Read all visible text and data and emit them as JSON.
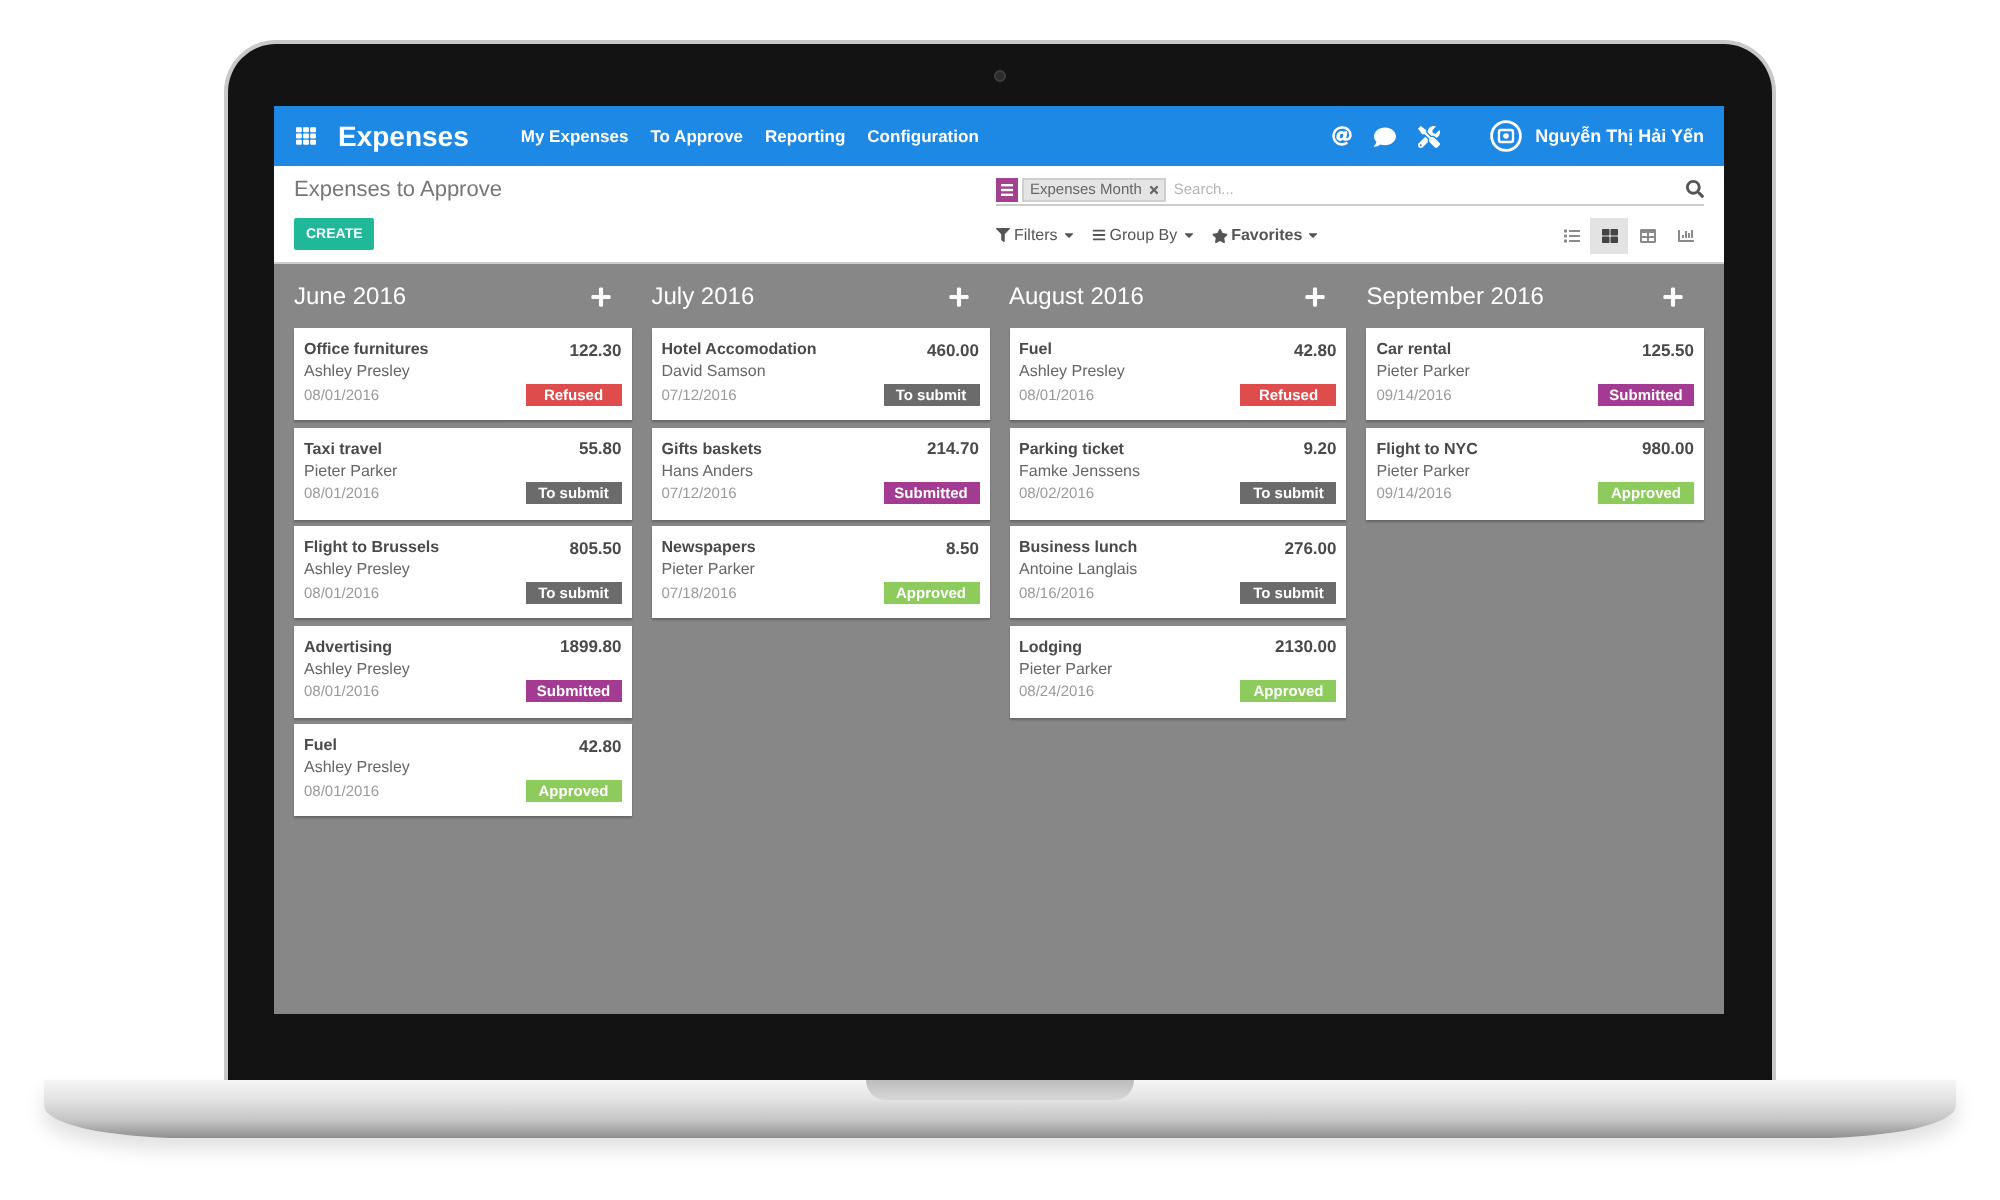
{
  "navbar": {
    "app_name": "Expenses",
    "menu": [
      "My Expenses",
      "To Approve",
      "Reporting",
      "Configuration"
    ],
    "user": "Nguyễn Thị Hải Yến"
  },
  "control_panel": {
    "breadcrumb": "Expenses to Approve",
    "create_button": "CREATE",
    "search": {
      "facets": [
        {
          "label": "Expenses Month"
        }
      ],
      "placeholder": "Search..."
    },
    "filter_menus": [
      {
        "kind": "filters",
        "label": "Filters"
      },
      {
        "kind": "group_by",
        "label": "Group By"
      },
      {
        "kind": "favorites",
        "label": "Favorites"
      }
    ],
    "views": [
      {
        "kind": "list",
        "selected": false
      },
      {
        "kind": "kanban",
        "selected": true
      },
      {
        "kind": "pivot",
        "selected": false
      },
      {
        "kind": "graph",
        "selected": false
      }
    ]
  },
  "columns": [
    {
      "title": "June 2016",
      "cards": [
        {
          "name": "Office furnitures",
          "amount": "122.30",
          "employee": "Ashley Presley",
          "date": "08/01/2016",
          "status": "Refused",
          "color": "#de4c4c"
        },
        {
          "name": "Taxi travel",
          "amount": "55.80",
          "employee": "Pieter Parker",
          "date": "08/01/2016",
          "status": "To submit",
          "color": "#6b6b6b"
        },
        {
          "name": "Flight to Brussels",
          "amount": "805.50",
          "employee": "Ashley Presley",
          "date": "08/01/2016",
          "status": "To submit",
          "color": "#6b6b6b"
        },
        {
          "name": "Advertising",
          "amount": "1899.80",
          "employee": "Ashley Presley",
          "date": "08/01/2016",
          "status": "Submitted",
          "color": "#a33b92"
        },
        {
          "name": "Fuel",
          "amount": "42.80",
          "employee": "Ashley Presley",
          "date": "08/01/2016",
          "status": "Approved",
          "color": "#8ecb5d"
        }
      ]
    },
    {
      "title": "July 2016",
      "cards": [
        {
          "name": "Hotel Accomodation",
          "amount": "460.00",
          "employee": "David Samson",
          "date": "07/12/2016",
          "status": "To submit",
          "color": "#6b6b6b"
        },
        {
          "name": "Gifts baskets",
          "amount": "214.70",
          "employee": "Hans Anders",
          "date": "07/12/2016",
          "status": "Submitted",
          "color": "#a33b92"
        },
        {
          "name": "Newspapers",
          "amount": "8.50",
          "employee": "Pieter Parker",
          "date": "07/18/2016",
          "status": "Approved",
          "color": "#8ecb5d"
        }
      ]
    },
    {
      "title": "August 2016",
      "cards": [
        {
          "name": "Fuel",
          "amount": "42.80",
          "employee": "Ashley Presley",
          "date": "08/01/2016",
          "status": "Refused",
          "color": "#de4c4c"
        },
        {
          "name": "Parking ticket",
          "amount": "9.20",
          "employee": "Famke Jenssens",
          "date": "08/02/2016",
          "status": "To submit",
          "color": "#6b6b6b"
        },
        {
          "name": "Business lunch",
          "amount": "276.00",
          "employee": "Antoine Langlais",
          "date": "08/16/2016",
          "status": "To submit",
          "color": "#6b6b6b"
        },
        {
          "name": "Lodging",
          "amount": "2130.00",
          "employee": "Pieter Parker",
          "date": "08/24/2016",
          "status": "Approved",
          "color": "#8ecb5d"
        }
      ]
    },
    {
      "title": "September 2016",
      "cards": [
        {
          "name": "Car rental",
          "amount": "125.50",
          "employee": "Pieter Parker",
          "date": "09/14/2016",
          "status": "Submitted",
          "color": "#a33b92"
        },
        {
          "name": "Flight to NYC",
          "amount": "980.00",
          "employee": "Pieter Parker",
          "date": "09/14/2016",
          "status": "Approved",
          "color": "#8ecb5d"
        }
      ]
    }
  ]
}
